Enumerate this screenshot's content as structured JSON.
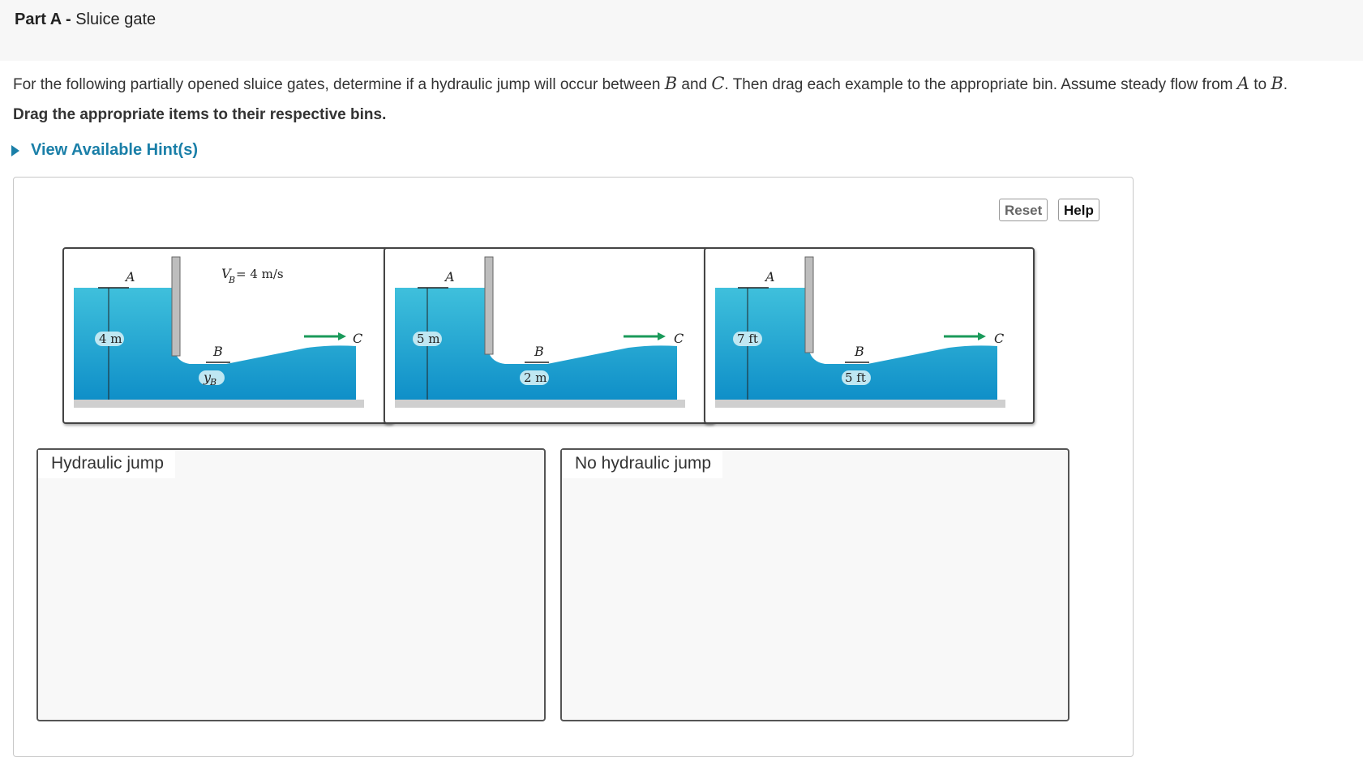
{
  "header": {
    "part_prefix": "Part A -",
    "part_title": "Sluice gate"
  },
  "question": {
    "text_1": "For the following partially opened sluice gates, determine if a hydraulic jump will occur between",
    "var_b": "B",
    "text_2": "and",
    "var_c": "C",
    "text_3": ". Then drag each example to the appropriate bin. Assume steady flow from",
    "var_a": "A",
    "text_4": "to",
    "var_b2": "B",
    "text_5": "."
  },
  "instruction": "Drag the appropriate items to their respective bins.",
  "hint_label": "View Available Hint(s)",
  "toolbar": {
    "reset_label": "Reset",
    "help_label": "Help"
  },
  "accent_colors": {
    "link": "#1a7fa8",
    "water": "#1fa8d6",
    "flow_arrow": "#1a9a5a"
  },
  "cards": [
    {
      "label_a": "A",
      "label_b": "B",
      "label_c": "C",
      "depth_a": "4 m",
      "depth_b": "y",
      "depth_b_sub": "B",
      "velocity": "V",
      "velocity_sub": "B",
      "velocity_value": "= 4 m/s"
    },
    {
      "label_a": "A",
      "label_b": "B",
      "label_c": "C",
      "depth_a": "5 m",
      "depth_b": "2 m"
    },
    {
      "label_a": "A",
      "label_b": "B",
      "label_c": "C",
      "depth_a": "7 ft",
      "depth_b": "5 ft"
    }
  ],
  "bins": [
    {
      "label": "Hydraulic jump"
    },
    {
      "label": "No hydraulic jump"
    }
  ]
}
